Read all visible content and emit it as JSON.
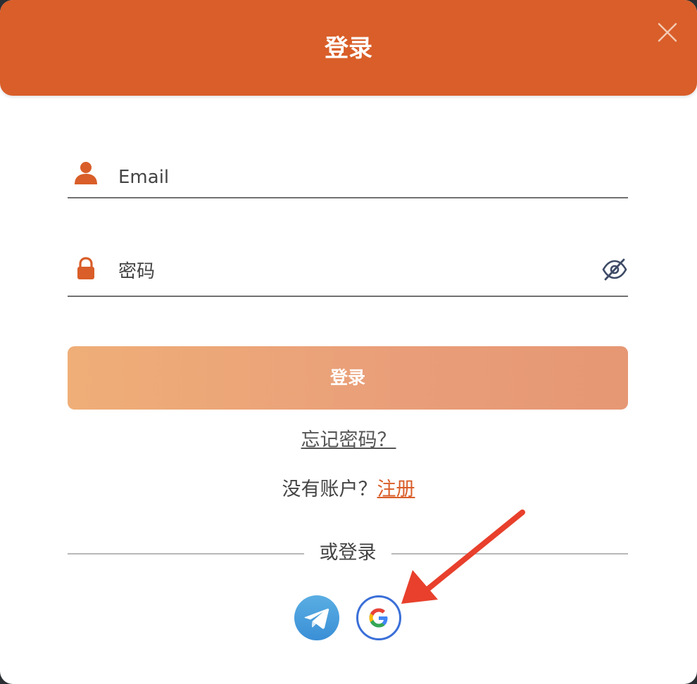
{
  "header": {
    "title": "登录",
    "close_icon": "close-icon"
  },
  "form": {
    "email_placeholder": "Email",
    "password_placeholder": "密码",
    "login_label": "登录",
    "forgot_label": "忘记密码？",
    "no_account_label": "没有账户？",
    "register_label": "注册"
  },
  "social": {
    "divider_label": "或登录",
    "buttons": [
      "telegram-icon",
      "google-icon"
    ]
  },
  "colors": {
    "accent": "#d95e29",
    "button_start": "#efae78",
    "button_end": "#e69774",
    "annotation_arrow": "#e8402c"
  }
}
